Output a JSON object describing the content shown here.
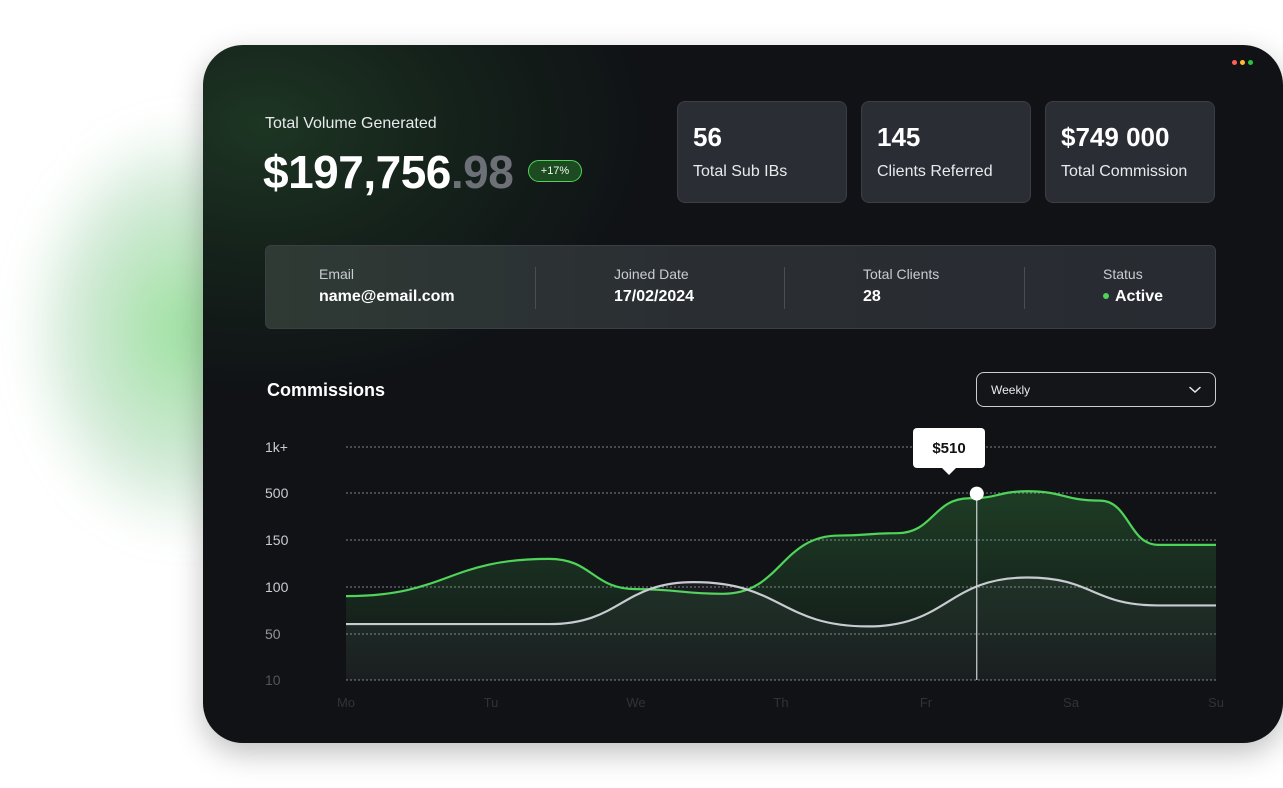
{
  "summary": {
    "volume_label": "Total Volume Generated",
    "volume_main": "$197,756",
    "volume_cents": ".98",
    "change_badge": "+17%"
  },
  "stats": [
    {
      "value": "56",
      "label": "Total Sub IBs"
    },
    {
      "value": "145",
      "label": "Clients Referred"
    },
    {
      "value": "$749 000",
      "label": "Total Commission"
    }
  ],
  "info": {
    "email_label": "Email",
    "email_value": "name@email.com",
    "joined_label": "Joined Date",
    "joined_value": "17/02/2024",
    "clients_label": "Total Clients",
    "clients_value": "28",
    "status_label": "Status",
    "status_value": "Active"
  },
  "commissions": {
    "title": "Commissions",
    "period_selected": "Weekly",
    "tooltip": "$510"
  },
  "colors": {
    "accent_green": "#4fd45a",
    "line_secondary": "#c8cbd0",
    "window_dots": [
      "#ff5f57",
      "#febc2e",
      "#28c840"
    ]
  },
  "chart_data": {
    "type": "line",
    "y_ticks": [
      "1k+",
      "500",
      "150",
      "100",
      "50",
      "10"
    ],
    "x_ticks": [
      "Mo",
      "Tu",
      "We",
      "Th",
      "Fr",
      "Sa",
      "Su"
    ],
    "x_positions": [
      0,
      1,
      2,
      3,
      4,
      5,
      6
    ],
    "series": [
      {
        "color": "#4fd45a",
        "points": [
          [
            0,
            1.8
          ],
          [
            1.4,
            2.6
          ],
          [
            2.0,
            1.95
          ],
          [
            2.6,
            1.85
          ],
          [
            3.4,
            3.1
          ],
          [
            3.8,
            3.15
          ],
          [
            4.3,
            3.9
          ],
          [
            4.7,
            4.05
          ],
          [
            5.2,
            3.85
          ],
          [
            5.6,
            2.9
          ],
          [
            6,
            2.9
          ]
        ]
      },
      {
        "color": "#c8cbd0",
        "points": [
          [
            0,
            1.2
          ],
          [
            1.4,
            1.2
          ],
          [
            2.4,
            2.1
          ],
          [
            3.6,
            1.15
          ],
          [
            4.7,
            2.2
          ],
          [
            5.6,
            1.6
          ],
          [
            6,
            1.6
          ]
        ]
      }
    ],
    "marker": {
      "x": 4.35,
      "y": 4.0,
      "label": "$510"
    },
    "grid": true
  }
}
